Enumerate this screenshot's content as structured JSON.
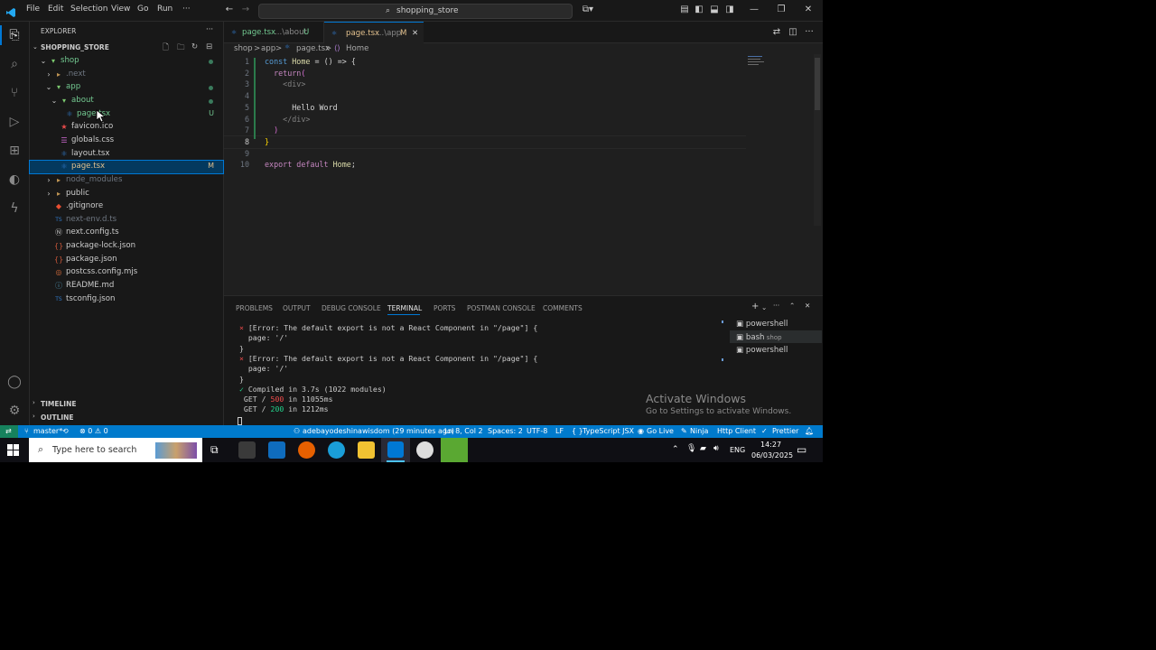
{
  "menu": [
    "File",
    "Edit",
    "Selection",
    "View",
    "Go",
    "Run",
    "···"
  ],
  "command_center": {
    "label": "shopping_store"
  },
  "explorer": {
    "header": "EXPLORER",
    "project": "SHOPPING_STORE",
    "items": [
      {
        "label": "shop",
        "type": "folder-open",
        "color": "#73c991",
        "dot": true
      },
      {
        "label": ".next",
        "type": "folder",
        "color": "#6e7681"
      },
      {
        "label": "app",
        "type": "folder-open",
        "color": "#73c991",
        "dot": true
      },
      {
        "label": "about",
        "type": "folder-open",
        "color": "#73c991",
        "dot": true
      },
      {
        "label": "page.tsx",
        "type": "tsx",
        "color": "#73c991",
        "badge": "U"
      },
      {
        "label": "favicon.ico",
        "type": "ico",
        "color": "#cccccc"
      },
      {
        "label": "globals.css",
        "type": "css",
        "color": "#cccccc"
      },
      {
        "label": "layout.tsx",
        "type": "tsx",
        "color": "#cccccc"
      },
      {
        "label": "page.tsx",
        "type": "tsx",
        "color": "#e2c08d",
        "badge": "M"
      },
      {
        "label": "node_modules",
        "type": "folder",
        "color": "#6e7681"
      },
      {
        "label": "public",
        "type": "folder",
        "color": "#cccccc"
      },
      {
        "label": ".gitignore",
        "type": "git",
        "color": "#cccccc"
      },
      {
        "label": "next-env.d.ts",
        "type": "ts",
        "color": "#6e7681"
      },
      {
        "label": "next.config.ts",
        "type": "cfg",
        "color": "#cccccc"
      },
      {
        "label": "package-lock.json",
        "type": "json",
        "color": "#cccccc"
      },
      {
        "label": "package.json",
        "type": "json",
        "color": "#cccccc"
      },
      {
        "label": "postcss.config.mjs",
        "type": "js",
        "color": "#cccccc"
      },
      {
        "label": "README.md",
        "type": "md",
        "color": "#cccccc"
      },
      {
        "label": "tsconfig.json",
        "type": "ts",
        "color": "#cccccc"
      }
    ],
    "timeline": "TIMELINE",
    "outline": "OUTLINE"
  },
  "tabs": [
    {
      "name": "page.tsx",
      "path": "...\\about",
      "badge": "U"
    },
    {
      "name": "page.tsx",
      "path": "...\\app",
      "badge": "M"
    }
  ],
  "breadcrumb": [
    "shop",
    ">",
    "app",
    ">",
    "page.tsx",
    ">",
    "Home"
  ],
  "code": {
    "line_numbers": [
      "1",
      "2",
      "3",
      "4",
      "5",
      "6",
      "7",
      "8",
      "9",
      "10"
    ],
    "lines": [
      [
        {
          "t": "const ",
          "c": "#569cd6"
        },
        {
          "t": "Home",
          "c": "#dcdcaa"
        },
        {
          "t": " = () => {",
          "c": "#d4d4d4"
        }
      ],
      [
        {
          "t": "  return",
          "c": "#c586c0"
        },
        {
          "t": "(",
          "c": "#da70d6"
        }
      ],
      [
        {
          "t": "    <div>",
          "c": "#808080"
        }
      ],
      [],
      [
        {
          "t": "      Hello Word",
          "c": "#d4d4d4"
        }
      ],
      [
        {
          "t": "    </div>",
          "c": "#808080"
        }
      ],
      [
        {
          "t": "  )",
          "c": "#da70d6"
        }
      ],
      [
        {
          "t": "}",
          "c": "#ffd700"
        }
      ],
      [],
      [
        {
          "t": "export ",
          "c": "#c586c0"
        },
        {
          "t": "default ",
          "c": "#c586c0"
        },
        {
          "t": "Home",
          "c": "#dcdcaa"
        },
        {
          "t": ";",
          "c": "#d4d4d4"
        }
      ]
    ]
  },
  "panel": {
    "tabs": [
      "PROBLEMS",
      "OUTPUT",
      "DEBUG CONSOLE",
      "TERMINAL",
      "PORTS",
      "POSTMAN CONSOLE",
      "COMMENTS"
    ],
    "active_tab": "TERMINAL",
    "terminal": [
      "⨯ [Error: The default export is not a React Component in \"/page\"] {",
      "  page: '/'",
      "}",
      "⨯ [Error: The default export is not a React Component in \"/page\"] {",
      "  page: '/'",
      "}",
      "✓ Compiled in 3.7s (1022 modules)",
      " GET / 500 in 11055ms",
      " GET / 200 in 1212ms"
    ],
    "shells": [
      {
        "label": "powershell",
        "sub": ""
      },
      {
        "label": "bash",
        "sub": "shop"
      },
      {
        "label": "powershell",
        "sub": ""
      }
    ]
  },
  "watermark": {
    "title": "Activate Windows",
    "subtitle": "Go to Settings to activate Windows."
  },
  "status": {
    "branch": "master*",
    "problems": "⊗ 0 ⚠ 0",
    "blame": "adebayodeshinawisdom (29 minutes ago)",
    "position": "Ln 8, Col 2",
    "spaces": "Spaces: 2",
    "encoding": "UTF-8",
    "eol": "LF",
    "language": "TypeScript JSX",
    "golive": "Go Live",
    "ninja": "Ninja",
    "http": "Http Client",
    "prettier": "Prettier"
  },
  "taskbar": {
    "search_placeholder": "Type here to search",
    "lang": "ENG",
    "time": "14:27",
    "date": "06/03/2025"
  },
  "colors": {
    "accent": "#007acc",
    "selected": "#04395e"
  }
}
